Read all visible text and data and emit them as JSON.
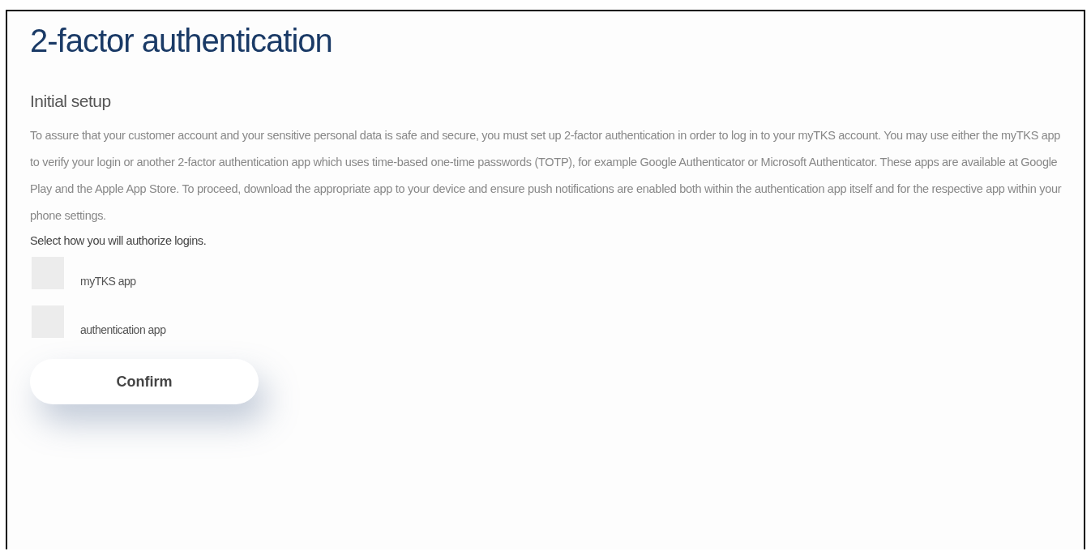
{
  "title": "2-factor authentication",
  "section": {
    "heading": "Initial setup",
    "description": "To assure that your customer account and your sensitive personal data is safe and secure, you must set up 2-factor authentication in order to log in to your myTKS account. You may use either the myTKS app to verify your login or another 2-factor authentication app which uses time-based one-time passwords (TOTP), for example Google Authenticator or Microsoft Authenticator. These apps are available at Google Play and the Apple App Store. To proceed, download the appropriate app to your device and ensure push notifications are enabled both within the authentication app itself and for the respective app within your phone settings.",
    "prompt": "Select how you will authorize logins.",
    "options": [
      {
        "label": "myTKS app",
        "checked": false
      },
      {
        "label": "authentication app",
        "checked": false
      }
    ],
    "button": "Confirm"
  }
}
